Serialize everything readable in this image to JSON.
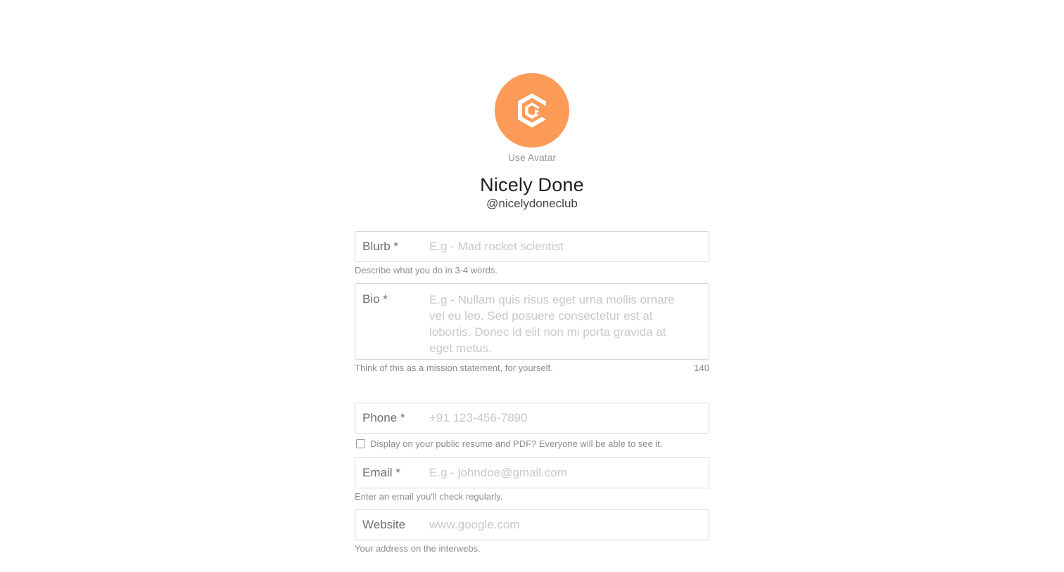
{
  "profile": {
    "use_avatar_label": "Use Avatar",
    "name": "Nicely Done",
    "handle": "@nicelydoneclub",
    "avatar_color": "#fc9a58",
    "avatar_icon": "hexagon-logo-icon"
  },
  "form": {
    "blurb": {
      "label": "Blurb *",
      "placeholder": "E.g - Mad rocket scientist",
      "value": "",
      "help": "Describe what you do in 3-4 words."
    },
    "bio": {
      "label": "Bio *",
      "placeholder": "E.g - Nullam quis risus eget urna mollis ornare vel eu leo. Sed posuere consectetur est at lobortis. Donec id elit non mi porta gravida at eget metus.",
      "value": "",
      "help": "Think of this as a mission statement, for yourself.",
      "counter": "140"
    },
    "phone": {
      "label": "Phone *",
      "placeholder": "+91 123-456-7890",
      "value": "",
      "checkbox_label": "Display on your public resume and PDF? Everyone will be able to see it.",
      "checkbox_checked": false
    },
    "email": {
      "label": "Email *",
      "placeholder": "E.g - johndoe@gmail.com",
      "value": "",
      "help": "Enter an email you'll check regularly."
    },
    "website": {
      "label": "Website",
      "placeholder": "www.google.com",
      "value": "",
      "help": "Your address on the interwebs."
    }
  }
}
